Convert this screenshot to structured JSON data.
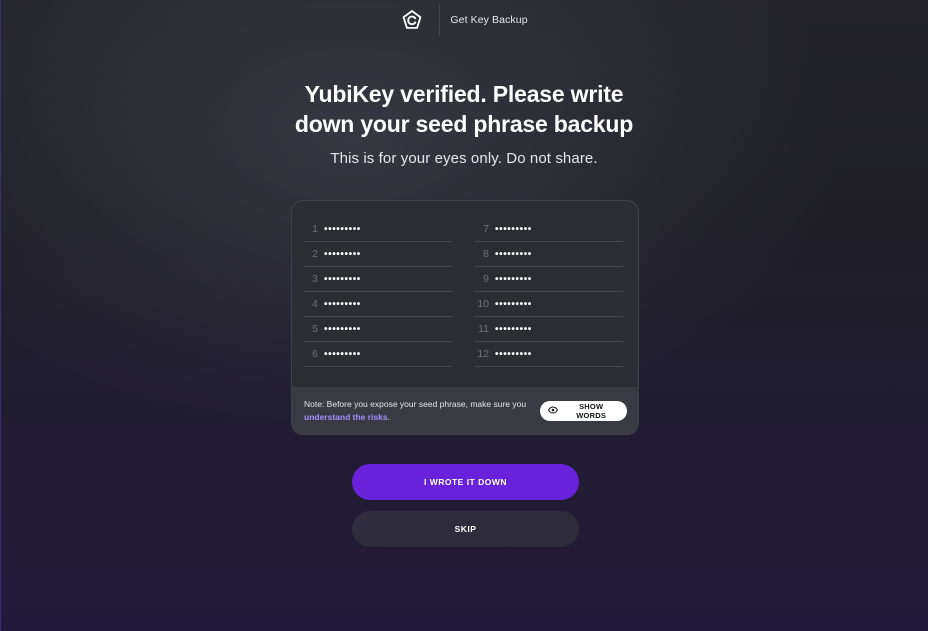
{
  "header": {
    "logo_icon": "get-key-logo-icon",
    "title": "Get Key Backup"
  },
  "main": {
    "headline_line1": "YubiKey verified. Please write",
    "headline_line2": "down your seed phrase backup",
    "subtitle": "This is for your eyes only. Do not share."
  },
  "seed_phrase": {
    "words": [
      {
        "num": "1",
        "value": "•••••••••"
      },
      {
        "num": "2",
        "value": "•••••••••"
      },
      {
        "num": "3",
        "value": "•••••••••"
      },
      {
        "num": "4",
        "value": "•••••••••"
      },
      {
        "num": "5",
        "value": "•••••••••"
      },
      {
        "num": "6",
        "value": "•••••••••"
      },
      {
        "num": "7",
        "value": "•••••••••"
      },
      {
        "num": "8",
        "value": "•••••••••"
      },
      {
        "num": "9",
        "value": "•••••••••"
      },
      {
        "num": "10",
        "value": "•••••••••"
      },
      {
        "num": "11",
        "value": "•••••••••"
      },
      {
        "num": "12",
        "value": "•••••••••"
      }
    ],
    "note_prefix": "Note: Before you expose your seed phrase, make sure you ",
    "note_link": "understand the risks",
    "note_suffix": ".",
    "show_words_label": "SHOW WORDS",
    "show_words_icon": "eye-icon"
  },
  "actions": {
    "primary_label": "I WROTE IT DOWN",
    "secondary_label": "SKIP"
  },
  "colors": {
    "accent": "#6823da",
    "link": "#a48bff"
  }
}
